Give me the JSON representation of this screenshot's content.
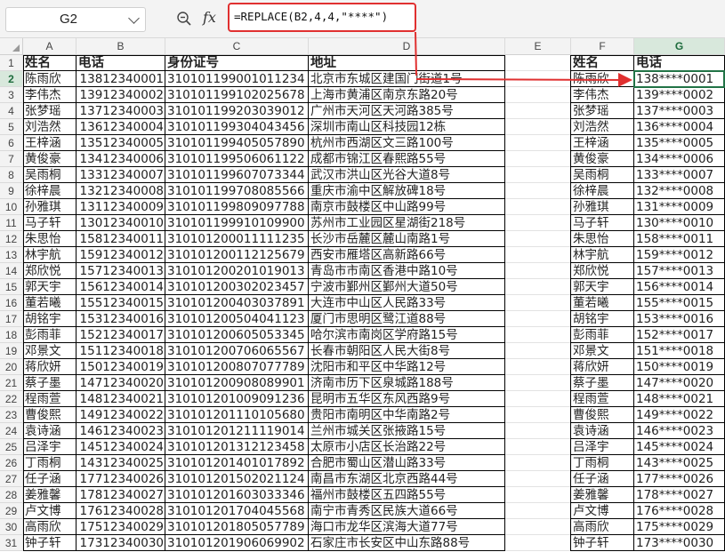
{
  "name_box": "G2",
  "formula": "=REPLACE(B2,4,4,\"****\")",
  "columns": [
    "A",
    "B",
    "C",
    "D",
    "E",
    "F",
    "G"
  ],
  "rows": [
    "1",
    "2",
    "3",
    "4",
    "5",
    "6",
    "7",
    "8",
    "9",
    "10",
    "11",
    "12",
    "13",
    "14",
    "15",
    "16",
    "17",
    "18",
    "19",
    "20",
    "21",
    "22",
    "23",
    "24",
    "25",
    "26",
    "27",
    "28",
    "29",
    "30",
    "31"
  ],
  "table1_headers": [
    "姓名",
    "电话",
    "身份证号",
    "地址"
  ],
  "table2_headers": [
    "姓名",
    "电话"
  ],
  "names": [
    "陈雨欣",
    "李伟杰",
    "张梦瑶",
    "刘浩然",
    "王梓涵",
    "黄俊豪",
    "吴雨桐",
    "徐梓晨",
    "孙雅琪",
    "马子轩",
    "朱思怡",
    "林宇航",
    "郑欣悦",
    "郭天宇",
    "董若曦",
    "胡铭宇",
    "彭雨菲",
    "邓景文",
    "蒋欣妍",
    "蔡子墨",
    "程雨萱",
    "曹俊熙",
    "袁诗涵",
    "吕泽宇",
    "丁雨桐",
    "任子涵",
    "姜雅馨",
    "卢文博",
    "高雨欣",
    "钟子轩"
  ],
  "phones": [
    "13812340001",
    "13912340002",
    "13712340003",
    "13612340004",
    "13512340005",
    "13412340006",
    "13312340007",
    "13212340008",
    "13112340009",
    "13012340010",
    "15812340011",
    "15912340012",
    "15712340013",
    "15612340014",
    "15512340015",
    "15312340016",
    "15212340017",
    "15112340018",
    "15012340019",
    "14712340020",
    "14812340021",
    "14912340022",
    "14612340023",
    "14512340024",
    "14312340025",
    "17712340026",
    "17812340027",
    "17612340028",
    "17512340029",
    "17312340030"
  ],
  "ids": [
    "310101199001011234",
    "310101199102025678",
    "310101199203039012",
    "310101199304043456",
    "310101199405057890",
    "310101199506061122",
    "310101199607073344",
    "310101199708085566",
    "310101199809097788",
    "310101199910109900",
    "310101200011111235",
    "310101200112125679",
    "310101200201019013",
    "310101200302023457",
    "310101200403037891",
    "310101200504041123",
    "310101200605053345",
    "310101200706065567",
    "310101200807077789",
    "310101200908089901",
    "310101201009091236",
    "310101201110105680",
    "310101201211119014",
    "310101201312123458",
    "310101201401017892",
    "310101201502021124",
    "310101201603033346",
    "310101201704045568",
    "310101201805057789",
    "310101201906069902"
  ],
  "addresses": [
    "北京市东城区建国门街道1号",
    "上海市黄浦区南京东路20号",
    "广州市天河区天河路385号",
    "深圳市南山区科技园12栋",
    "杭州市西湖区文三路100号",
    "成都市锦江区春熙路55号",
    "武汉市洪山区光谷大道8号",
    "重庆市渝中区解放碑18号",
    "南京市鼓楼区中山路99号",
    "苏州市工业园区星湖街218号",
    "长沙市岳麓区麓山南路1号",
    "西安市雁塔区高新路66号",
    "青岛市市南区香港中路10号",
    "宁波市鄞州区鄞州大道50号",
    "大连市中山区人民路33号",
    "厦门市思明区鹭江道88号",
    "哈尔滨市南岗区学府路15号",
    "长春市朝阳区人民大街8号",
    "沈阳市和平区中华路12号",
    "济南市历下区泉城路188号",
    "昆明市五华区东风西路9号",
    "贵阳市南明区中华南路2号",
    "兰州市城关区张掖路15号",
    "太原市小店区长治路22号",
    "合肥市蜀山区潜山路33号",
    "南昌市东湖区北京西路44号",
    "福州市鼓楼区五四路55号",
    "南宁市青秀区民族大道66号",
    "海口市龙华区滨海大道77号",
    "石家庄市长安区中山东路88号"
  ],
  "masked": [
    "138****0001",
    "139****0002",
    "137****0003",
    "136****0004",
    "135****0005",
    "134****0006",
    "133****0007",
    "132****0008",
    "131****0009",
    "130****0010",
    "158****0011",
    "159****0012",
    "157****0013",
    "156****0014",
    "155****0015",
    "153****0016",
    "152****0017",
    "151****0018",
    "150****0019",
    "147****0020",
    "148****0021",
    "149****0022",
    "146****0023",
    "145****0024",
    "143****0025",
    "177****0026",
    "178****0027",
    "176****0028",
    "175****0029",
    "173****0030"
  ],
  "colors": {
    "selection": "#217346",
    "highlight": "#e03030",
    "header_bg": "#f3f3f3"
  },
  "icons": [
    "chevron-down-icon",
    "zoom-icon",
    "fx-icon",
    "arrow-icon"
  ]
}
